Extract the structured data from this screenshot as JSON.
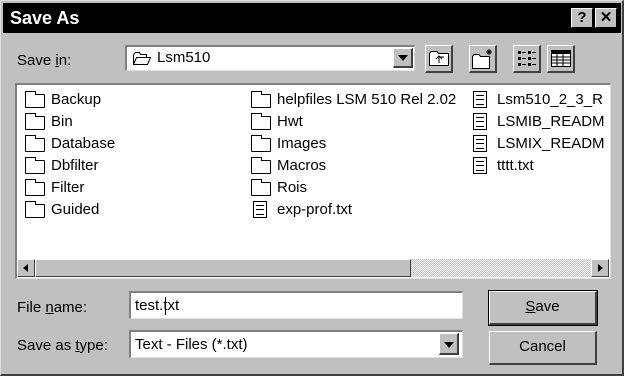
{
  "window": {
    "title": "Save As",
    "help_label": "?",
    "close_label": "✕"
  },
  "save_in": {
    "label_pre": "Save ",
    "label_key": "i",
    "label_post": "n:",
    "value": "Lsm510"
  },
  "toolbar": {
    "up_icon": "up-one-level-icon",
    "new_folder_icon": "new-folder-icon",
    "list_icon": "list-view-icon",
    "details_icon": "details-view-icon"
  },
  "files": {
    "col1": [
      "Backup",
      "Bin",
      "Database",
      "Dbfilter",
      "Filter",
      "Guided"
    ],
    "col2_folders": [
      "helpfiles LSM 510 Rel 2.02",
      "Hwt",
      "Images",
      "Macros",
      "Rois"
    ],
    "col2_file": "exp-prof.txt",
    "col3_files": [
      "Lsm510_2_3_R",
      "LSMIB_READM",
      "LSMIX_READM",
      "tttt.txt"
    ]
  },
  "file_name": {
    "label_pre": "File ",
    "label_key": "n",
    "label_post": "ame:",
    "value": "test.txt"
  },
  "save_type": {
    "label_pre": "Save as ",
    "label_key": "t",
    "label_post": "ype:",
    "value": "Text - Files (*.txt)"
  },
  "buttons": {
    "save_key": "S",
    "save_rest": "ave",
    "cancel": "Cancel"
  }
}
